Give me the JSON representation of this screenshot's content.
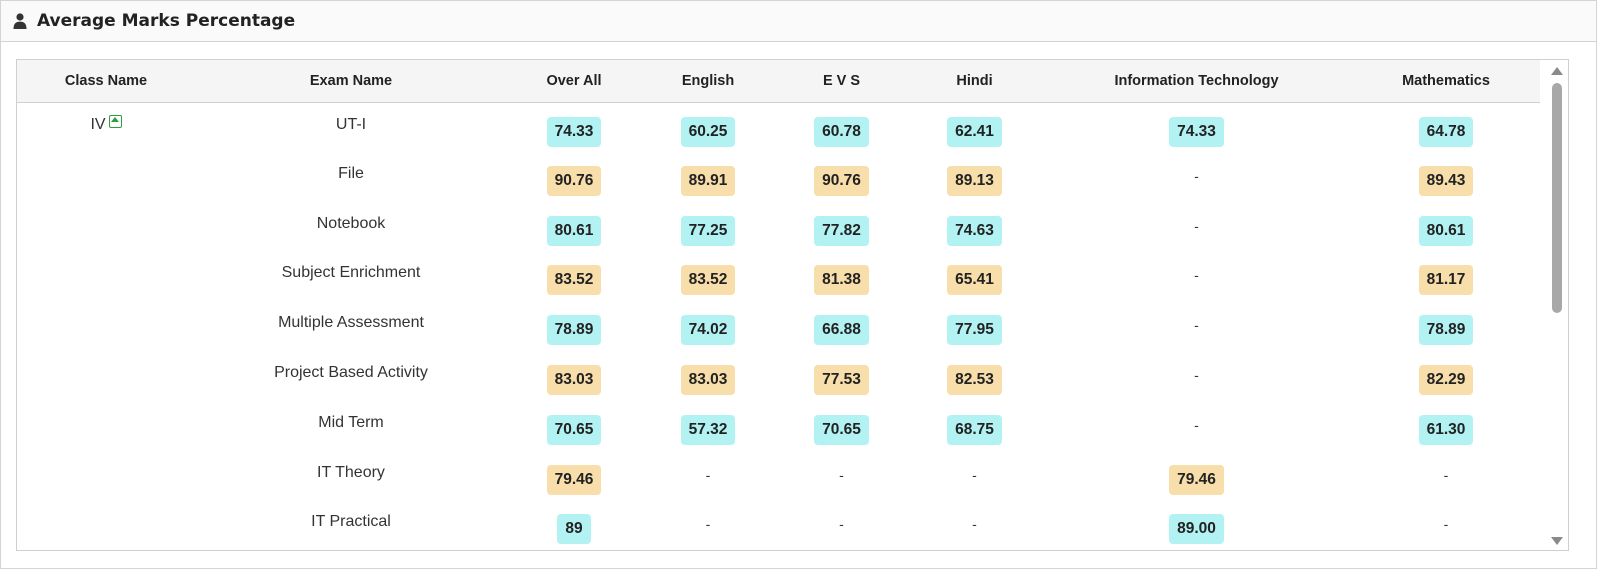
{
  "panel": {
    "title": "Average Marks Percentage",
    "icon": "user-icon"
  },
  "table": {
    "columns": [
      "Class Name",
      "Exam Name",
      "Over All",
      "English",
      "E V S",
      "Hindi",
      "Information Technology",
      "Mathematics"
    ],
    "class_name": "IV",
    "class_badge_icon": "expand-up-icon",
    "rows": [
      {
        "exam": "UT-I",
        "cells": [
          {
            "v": "74.33",
            "c": "cyan"
          },
          {
            "v": "60.25",
            "c": "cyan"
          },
          {
            "v": "60.78",
            "c": "cyan"
          },
          {
            "v": "62.41",
            "c": "cyan"
          },
          {
            "v": "74.33",
            "c": "cyan"
          },
          {
            "v": "64.78",
            "c": "cyan"
          }
        ]
      },
      {
        "exam": "File",
        "cells": [
          {
            "v": "90.76",
            "c": "tan"
          },
          {
            "v": "89.91",
            "c": "tan"
          },
          {
            "v": "90.76",
            "c": "tan"
          },
          {
            "v": "89.13",
            "c": "tan"
          },
          {
            "v": "-",
            "c": "none"
          },
          {
            "v": "89.43",
            "c": "tan"
          }
        ]
      },
      {
        "exam": "Notebook",
        "cells": [
          {
            "v": "80.61",
            "c": "cyan"
          },
          {
            "v": "77.25",
            "c": "cyan"
          },
          {
            "v": "77.82",
            "c": "cyan"
          },
          {
            "v": "74.63",
            "c": "cyan"
          },
          {
            "v": "-",
            "c": "none"
          },
          {
            "v": "80.61",
            "c": "cyan"
          }
        ]
      },
      {
        "exam": "Subject Enrichment",
        "cells": [
          {
            "v": "83.52",
            "c": "tan"
          },
          {
            "v": "83.52",
            "c": "tan"
          },
          {
            "v": "81.38",
            "c": "tan"
          },
          {
            "v": "65.41",
            "c": "tan"
          },
          {
            "v": "-",
            "c": "none"
          },
          {
            "v": "81.17",
            "c": "tan"
          }
        ]
      },
      {
        "exam": "Multiple Assessment",
        "cells": [
          {
            "v": "78.89",
            "c": "cyan"
          },
          {
            "v": "74.02",
            "c": "cyan"
          },
          {
            "v": "66.88",
            "c": "cyan"
          },
          {
            "v": "77.95",
            "c": "cyan"
          },
          {
            "v": "-",
            "c": "none"
          },
          {
            "v": "78.89",
            "c": "cyan"
          }
        ]
      },
      {
        "exam": "Project Based Activity",
        "cells": [
          {
            "v": "83.03",
            "c": "tan"
          },
          {
            "v": "83.03",
            "c": "tan"
          },
          {
            "v": "77.53",
            "c": "tan"
          },
          {
            "v": "82.53",
            "c": "tan"
          },
          {
            "v": "-",
            "c": "none"
          },
          {
            "v": "82.29",
            "c": "tan"
          }
        ]
      },
      {
        "exam": "Mid Term",
        "cells": [
          {
            "v": "70.65",
            "c": "cyan"
          },
          {
            "v": "57.32",
            "c": "cyan"
          },
          {
            "v": "70.65",
            "c": "cyan"
          },
          {
            "v": "68.75",
            "c": "cyan"
          },
          {
            "v": "-",
            "c": "none"
          },
          {
            "v": "61.30",
            "c": "cyan"
          }
        ]
      },
      {
        "exam": "IT Theory",
        "cells": [
          {
            "v": "79.46",
            "c": "tan"
          },
          {
            "v": "-",
            "c": "none"
          },
          {
            "v": "-",
            "c": "none"
          },
          {
            "v": "-",
            "c": "none"
          },
          {
            "v": "79.46",
            "c": "tan"
          },
          {
            "v": "-",
            "c": "none"
          }
        ]
      },
      {
        "exam": "IT Practical",
        "cells": [
          {
            "v": "89",
            "c": "cyan"
          },
          {
            "v": "-",
            "c": "none"
          },
          {
            "v": "-",
            "c": "none"
          },
          {
            "v": "-",
            "c": "none"
          },
          {
            "v": "89.00",
            "c": "cyan"
          },
          {
            "v": "-",
            "c": "none"
          }
        ]
      }
    ]
  },
  "colors": {
    "badge_cyan": "#b3f2f3",
    "badge_tan": "#f7deaa",
    "class_badge_green": "#2e9e3e"
  }
}
